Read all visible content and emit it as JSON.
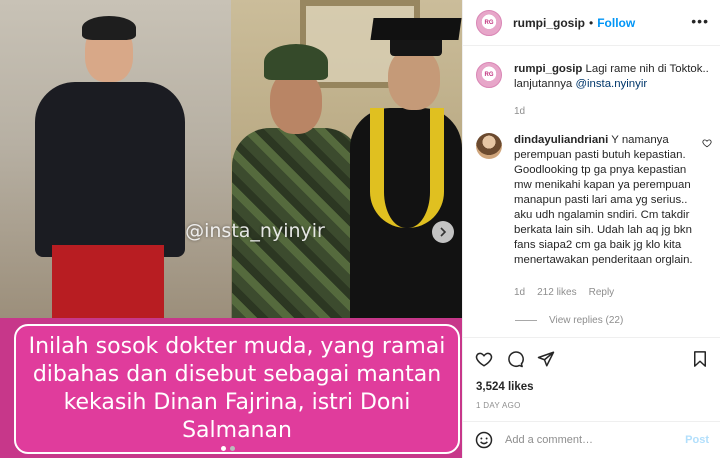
{
  "post": {
    "watermark": "@insta_nyinyir",
    "caption_overlay": "Inilah sosok dokter muda, yang ramai dibahas dan disebut sebagai mantan kekasih Dinan Fajrina, istri Doni Salmanan",
    "carousel": {
      "total_slides": 2,
      "active_slide": 1
    }
  },
  "header": {
    "username": "rumpi_gosip",
    "separator": "•",
    "follow_label": "Follow",
    "more_label": "•••"
  },
  "caption": {
    "username": "rumpi_gosip",
    "text": "Lagi rame nih di Toktok.. lanjutannya ",
    "mention": "@insta.nyinyir",
    "time": "1d"
  },
  "comment": {
    "username": "dindayuliandriani",
    "text": "Y namanya perempuan pasti butuh kepastian. Goodlooking tp ga pnya kepastian mw menikahi kapan ya perempuan manapun pasti lari ama yg serius.. aku udh ngalamin sndiri. Cm takdir berkata lain sih. Udah lah aq jg bkn fans siapa2 cm ga baik jg klo kita menertawakan penderitaan orglain.",
    "time": "1d",
    "likes": "212 likes",
    "reply_label": "Reply",
    "view_replies": "View replies (22)"
  },
  "actions": {
    "likes": "3,524 likes",
    "date": "1 DAY AGO"
  },
  "add_comment": {
    "placeholder": "Add a comment…",
    "post_label": "Post"
  },
  "colors": {
    "accent": "#0095f6",
    "caption_bg": "#e03c9c",
    "caption_border": "#ffffff",
    "secondary_text": "#8e8e8e"
  },
  "icons": [
    "chevron-right-icon",
    "heart-icon",
    "comment-icon",
    "share-icon",
    "bookmark-icon",
    "emoji-icon",
    "more-icon"
  ]
}
